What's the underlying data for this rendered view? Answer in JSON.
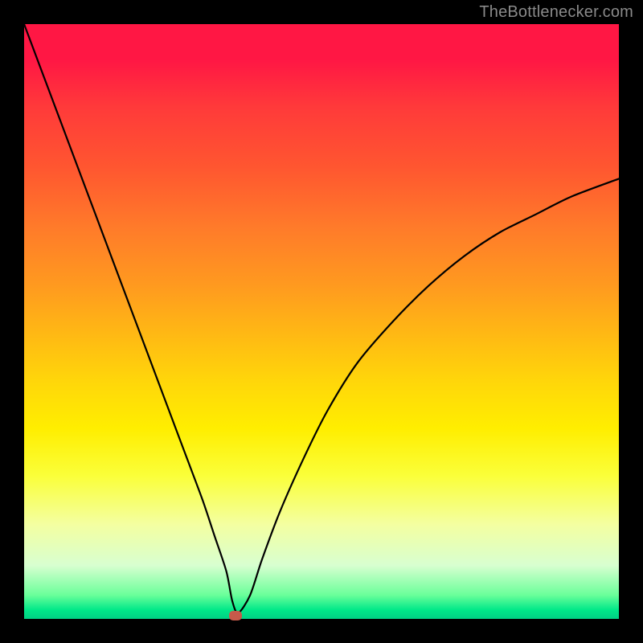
{
  "watermark": "TheBottlenecker.com",
  "colors": {
    "frame": "#000000",
    "curve": "#000000",
    "dot": "#c65a4a",
    "watermark_text": "#8a8a8a"
  },
  "chart_data": {
    "type": "line",
    "title": "",
    "xlabel": "",
    "ylabel": "",
    "xlim": [
      0,
      100
    ],
    "ylim": [
      0,
      100
    ],
    "series": [
      {
        "name": "bottleneck-curve",
        "x": [
          0,
          3,
          6,
          9,
          12,
          15,
          18,
          21,
          24,
          27,
          30,
          32,
          34,
          35,
          36,
          38,
          40,
          43,
          47,
          51,
          56,
          62,
          68,
          74,
          80,
          86,
          92,
          100
        ],
        "values": [
          100,
          92,
          84,
          76,
          68,
          60,
          52,
          44,
          36,
          28,
          20,
          14,
          8,
          3,
          1,
          4,
          10,
          18,
          27,
          35,
          43,
          50,
          56,
          61,
          65,
          68,
          71,
          74
        ]
      }
    ],
    "marker": {
      "x": 35.5,
      "y": 0.5,
      "shape": "rounded-rect"
    },
    "grid": false,
    "legend": false
  }
}
